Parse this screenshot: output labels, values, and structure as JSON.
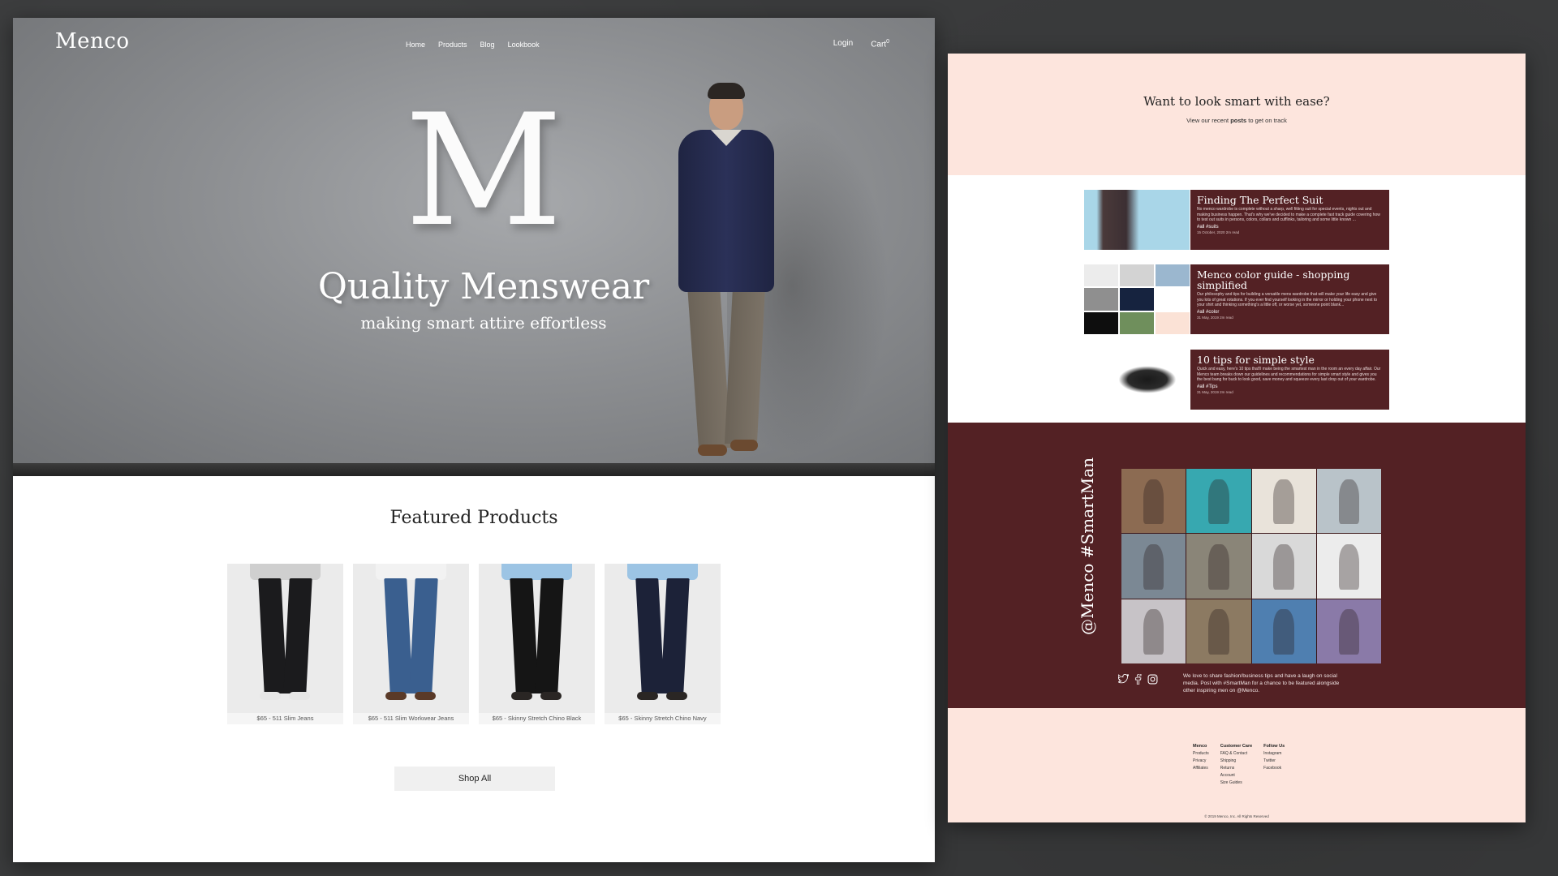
{
  "brand": {
    "logo": "Menco"
  },
  "nav": {
    "items": [
      "Home",
      "Products",
      "Blog",
      "Lookbook"
    ],
    "login": "Login",
    "cart": "Cart",
    "cart_count": "0"
  },
  "hero": {
    "letter": "M",
    "title": "Quality Menswear",
    "subtitle": "making smart attire effortless"
  },
  "featured": {
    "title": "Featured Products",
    "products": [
      {
        "caption": "$65 - 511 Slim Jeans",
        "color": "#1b1b1d",
        "shirt": "#cfcfcf",
        "shoe": "#e6e6e6"
      },
      {
        "caption": "$65 - 511 Slim Workwear Jeans",
        "color": "#3a5f8f",
        "shirt": "#f2f2f2",
        "shoe": "#5a3a28"
      },
      {
        "caption": "$65 - Skinny Stretch Chino Black",
        "color": "#151515",
        "shirt": "#9cc4e4",
        "shoe": "#2a2624"
      },
      {
        "caption": "$65 - Skinny Stretch Chino Navy",
        "color": "#1c2238",
        "shirt": "#9cc4e4",
        "shoe": "#2a2624"
      }
    ],
    "shop_all": "Shop All"
  },
  "blog": {
    "heading": "Want to look smart with ease?",
    "sub_prefix": "View our recent ",
    "sub_bold": "posts",
    "sub_suffix": " to get on track",
    "posts": [
      {
        "title": "Finding The Perfect Suit",
        "desc": "No menco wardrobe is complete without a sharp, well fitting suit for special events, nights out and making business happen. That's why we've decided to make a complete fast track guide covering how to test out suits in persons, colors, collars and cufflinks, tailoring and some little known ...",
        "tags": "#all #suits",
        "date": "15 October, 2020 2m read",
        "thumb": "#a9d6e8"
      },
      {
        "title": "Menco color guide - shopping simplified",
        "desc": "Our philosophy and tips for building a versatile mens wardrobe that will make your life easy and give you lots of great rotations. If you ever find yourself looking in the mirror or holding your phone next to your shirt and thinking something's a little off, or worse yet, someone point blank...",
        "tags": "#all #color",
        "date": "31 May, 2019 2m read",
        "thumb": "#ffffff"
      },
      {
        "title": "10 tips for simple style",
        "desc": "Quick and easy, here's 10 tips that'll make being the smartest man in the room an every day affair. Our Menco team breaks down our guidelines and recommendations for simple smart style and gives you the best bang for buck to look good, save money and squeeze every last drop out of your wardrobe.",
        "tags": "#all #Tips",
        "date": "31 May, 2019 2m read",
        "thumb": "#ffffff"
      }
    ],
    "swatches": [
      "#ececec",
      "#d3d3d3",
      "#9bb7cf",
      "#8f8f8f",
      "#16233f",
      "#ffffff",
      "#0e0e0e",
      "#6f8f5c",
      "#fbe2d6"
    ]
  },
  "social": {
    "tag": "@Menco #SmartMan",
    "tiles": [
      "#8c6b52",
      "#37a8b0",
      "#e9e3da",
      "#b9c3c9",
      "#7b8894",
      "#8a8578",
      "#d9d9d9",
      "#ececec",
      "#c7c3c7",
      "#8c7a62",
      "#4f7fb0",
      "#8a7aa8"
    ],
    "icons": [
      "twitter-icon",
      "facebook-icon",
      "instagram-icon"
    ],
    "text": "We love to share fashion/business tips and have a laugh on social media. Post with #SmartMan for a chance to be featured alongside other inspiring men on @Menco."
  },
  "footer": {
    "columns": [
      {
        "heading": "Menco",
        "links": [
          "Products",
          "Privacy",
          "Affiliates"
        ]
      },
      {
        "heading": "Customer Care",
        "links": [
          "FAQ & Contact",
          "Shipping",
          "Returns",
          "Account",
          "Size Guides"
        ]
      },
      {
        "heading": "Follow Us",
        "links": [
          "Instagram",
          "Twitter",
          "Facebook"
        ]
      }
    ],
    "copyright": "© 2019 Menco, Inc. All Rights Reserved"
  },
  "colors": {
    "maroon": "#532124",
    "blush": "#fde5dd",
    "backdrop": "#3a3b3c"
  }
}
